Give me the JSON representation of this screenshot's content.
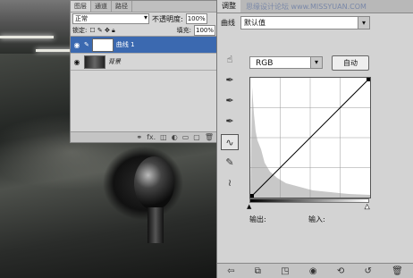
{
  "layers_panel": {
    "tabs": [
      "图层",
      "通道",
      "路径"
    ],
    "blend_mode": "正常",
    "opacity_label": "不透明度:",
    "opacity_value": "100%",
    "lock_label": "锁定:",
    "fill_label": "填充:",
    "fill_value": "100%",
    "layers": [
      {
        "name": "曲线 1",
        "selected": true
      },
      {
        "name": "背景",
        "selected": false
      }
    ],
    "footer_icons": [
      "link-icon",
      "fx-icon",
      "mask-icon",
      "adjustment-icon",
      "folder-icon",
      "new-layer-icon",
      "trash-icon"
    ]
  },
  "adjustments_panel": {
    "tab": "调整",
    "watermark": "思缘设计论坛 www.MISSYUAN.COM",
    "type_label": "曲线",
    "preset_value": "默认值",
    "channel_value": "RGB",
    "auto_button": "自动",
    "output_label": "输出:",
    "input_label": "输入:"
  }
}
